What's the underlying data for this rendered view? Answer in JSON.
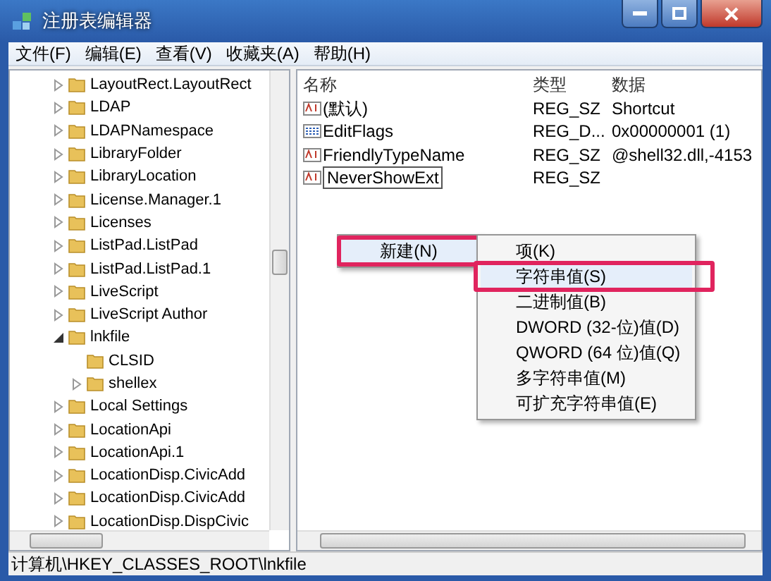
{
  "window": {
    "title": "注册表编辑器"
  },
  "menu_bar": [
    "文件(F)",
    "编辑(E)",
    "查看(V)",
    "收藏夹(A)",
    "帮助(H)"
  ],
  "tree": [
    {
      "label": "LayoutRect.LayoutRect",
      "kind": "branch",
      "expanded": false
    },
    {
      "label": "LDAP",
      "kind": "branch",
      "expanded": false
    },
    {
      "label": "LDAPNamespace",
      "kind": "branch",
      "expanded": false
    },
    {
      "label": "LibraryFolder",
      "kind": "branch",
      "expanded": false
    },
    {
      "label": "LibraryLocation",
      "kind": "branch",
      "expanded": false
    },
    {
      "label": "License.Manager.1",
      "kind": "branch",
      "expanded": false
    },
    {
      "label": "Licenses",
      "kind": "branch",
      "expanded": false
    },
    {
      "label": "ListPad.ListPad",
      "kind": "branch",
      "expanded": false
    },
    {
      "label": "ListPad.ListPad.1",
      "kind": "branch",
      "expanded": false
    },
    {
      "label": "LiveScript",
      "kind": "branch",
      "expanded": false
    },
    {
      "label": "LiveScript Author",
      "kind": "branch",
      "expanded": false
    },
    {
      "label": "lnkfile",
      "kind": "branch",
      "expanded": true,
      "children": [
        {
          "label": "CLSID",
          "kind": "leaf"
        },
        {
          "label": "shellex",
          "kind": "branch",
          "expanded": false
        }
      ]
    },
    {
      "label": "Local Settings",
      "kind": "branch",
      "expanded": false
    },
    {
      "label": "LocationApi",
      "kind": "branch",
      "expanded": false
    },
    {
      "label": "LocationApi.1",
      "kind": "branch",
      "expanded": false
    },
    {
      "label": "LocationDisp.CivicAdd",
      "kind": "branch",
      "expanded": false
    },
    {
      "label": "LocationDisp.CivicAdd",
      "kind": "branch",
      "expanded": false
    },
    {
      "label": "LocationDisp.DispCivic",
      "kind": "branch",
      "expanded": false
    }
  ],
  "values": {
    "columns": [
      "名称",
      "类型",
      "数据"
    ],
    "rows": [
      {
        "kind": "string",
        "name": "(默认)",
        "type": "REG_SZ",
        "data": "Shortcut",
        "editing": false
      },
      {
        "kind": "binary",
        "name": "EditFlags",
        "type": "REG_D...",
        "data": "0x00000001 (1)",
        "editing": false
      },
      {
        "kind": "string",
        "name": "FriendlyTypeName",
        "type": "REG_SZ",
        "data": "@shell32.dll,-4153",
        "editing": false
      },
      {
        "kind": "string",
        "name": "NeverShowExt",
        "type": "REG_SZ",
        "editing": true
      }
    ]
  },
  "context_menu": {
    "items": [
      {
        "label": "新建(N)",
        "highlighted": true
      }
    ]
  },
  "submenu": {
    "items": [
      {
        "label": "项(K)",
        "highlighted": false
      },
      {
        "label": "字符串值(S)",
        "highlighted": true
      },
      {
        "label": "二进制值(B)",
        "highlighted": false
      },
      {
        "label": "DWORD (32-位)值(D)",
        "highlighted": false
      },
      {
        "label": "QWORD (64 位)值(Q)",
        "highlighted": false
      },
      {
        "label": "多字符串值(M)",
        "highlighted": false
      },
      {
        "label": "可扩充字符串值(E)",
        "highlighted": false
      }
    ]
  },
  "status_bar": "计算机\\HKEY_CLASSES_ROOT\\lnkfile"
}
